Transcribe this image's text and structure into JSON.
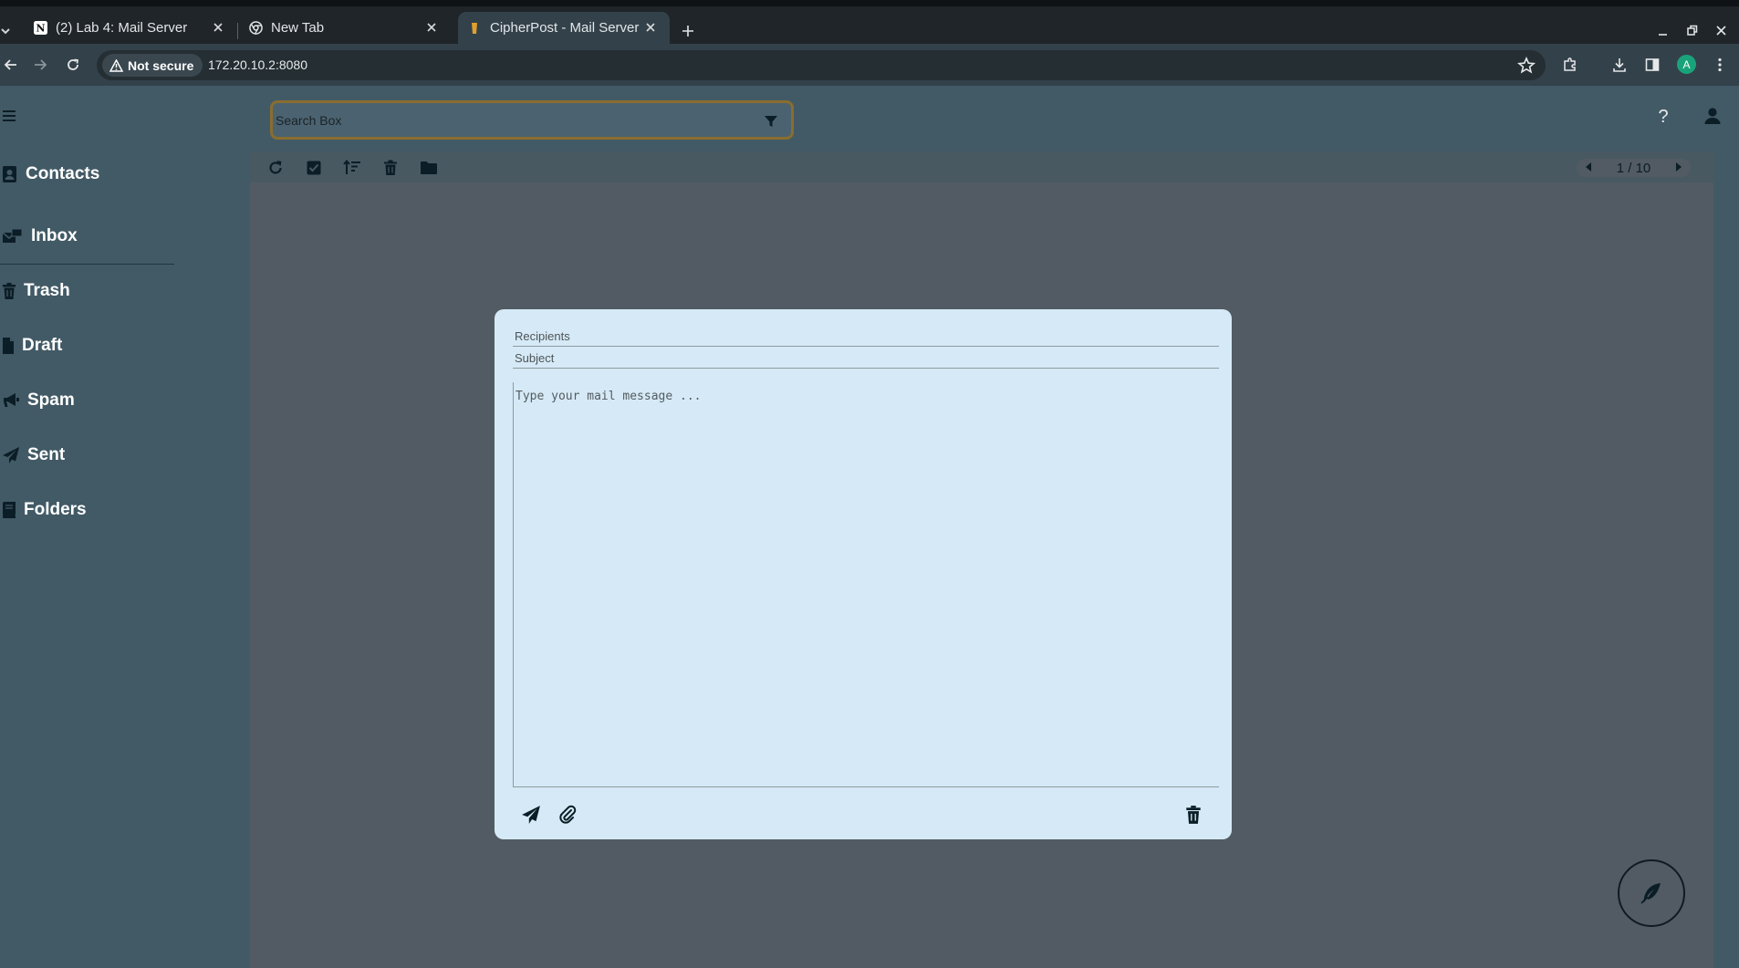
{
  "browser": {
    "tabs": [
      {
        "label": "(2) Lab 4: Mail Server",
        "icon": "notion-icon"
      },
      {
        "label": "New Tab",
        "icon": "chrome-icon"
      },
      {
        "label": "CipherPost - Mail Server",
        "icon": "mail-server-favicon"
      }
    ],
    "security_label": "Not secure",
    "url": "172.20.10.2:8080",
    "profile_initial": "A"
  },
  "app": {
    "search_placeholder": "Search Box",
    "help_symbol": "?",
    "sidebar": [
      {
        "label": "Contacts",
        "icon": "contacts-icon"
      },
      {
        "label": "Inbox",
        "icon": "inbox-icon"
      },
      {
        "label": "Trash",
        "icon": "trash-icon"
      },
      {
        "label": "Draft",
        "icon": "draft-icon"
      },
      {
        "label": "Spam",
        "icon": "megaphone-icon"
      },
      {
        "label": "Sent",
        "icon": "paper-plane-icon"
      },
      {
        "label": "Folders",
        "icon": "book-icon"
      }
    ],
    "pager": {
      "current": 1,
      "total": 10,
      "label": "1 / 10"
    },
    "compose": {
      "recipients_placeholder": "Recipients",
      "subject_placeholder": "Subject",
      "message_placeholder": "Type your mail message ..."
    }
  },
  "colors": {
    "app_background": "#425a66",
    "panel": "#525b63",
    "compose_background": "#d5eaf6",
    "search_border": "#8a6d2e",
    "icon_dark": "#0b1d26"
  }
}
